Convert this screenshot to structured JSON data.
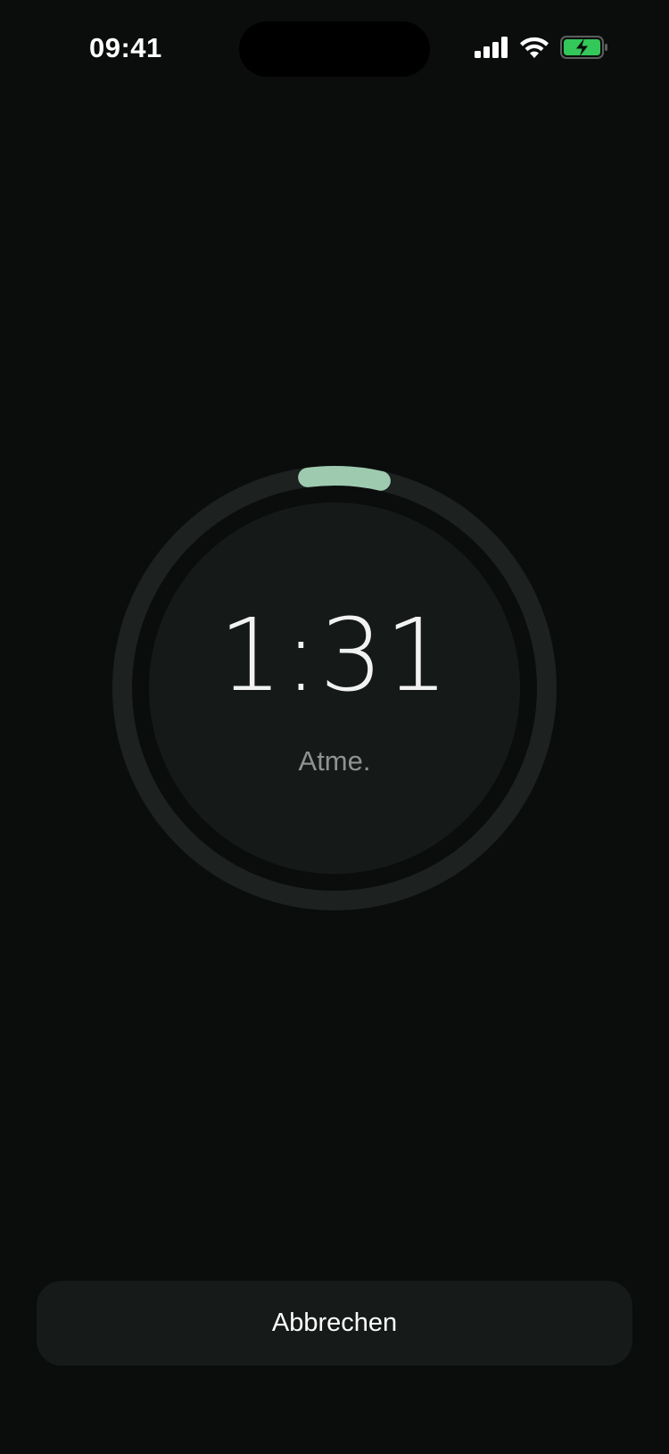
{
  "status_bar": {
    "time": "09:41",
    "icons": [
      "cellular-signal-icon",
      "wifi-icon",
      "battery-charging-icon"
    ]
  },
  "timer": {
    "display": "1:31",
    "label": "Atme.",
    "progress_fraction": 0.055,
    "progress_color": "#9ecbb0",
    "track_color": "#1d2120",
    "inner_color": "#151a19"
  },
  "actions": {
    "cancel_label": "Abbrechen"
  },
  "colors": {
    "background": "#0b0d0c",
    "battery_fill": "#34c759"
  }
}
